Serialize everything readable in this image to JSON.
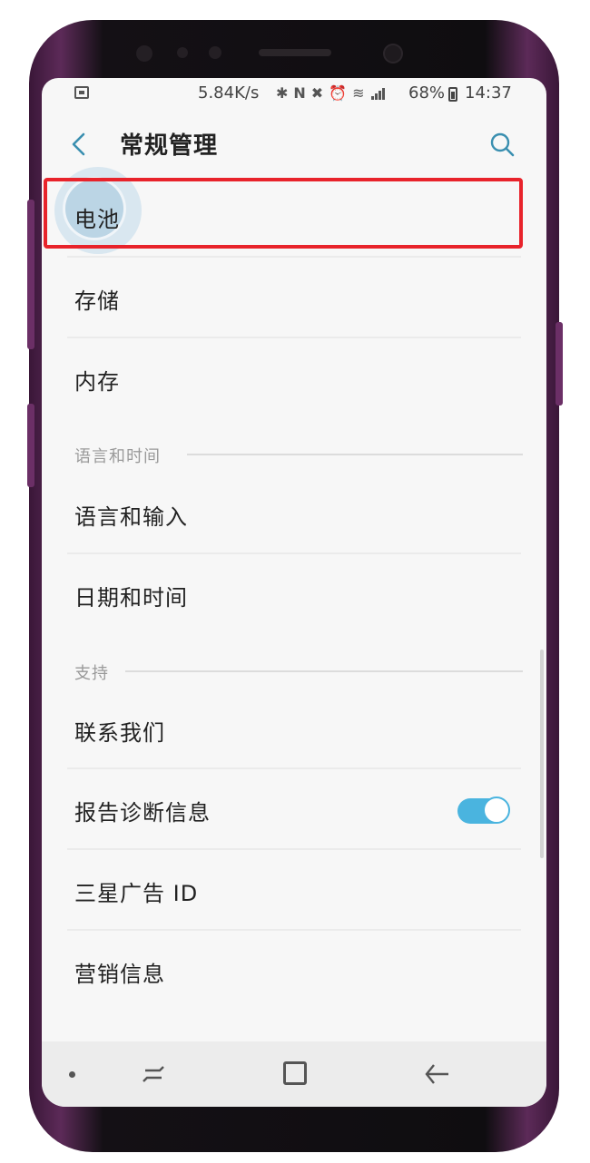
{
  "status_bar": {
    "net_speed": "5.84K/s",
    "icons": [
      "bluetooth-icon",
      "nfc-icon",
      "mute-icon",
      "alarm-icon",
      "wifi-icon",
      "signal-icon"
    ],
    "battery_percent": "68%",
    "time": "14:37"
  },
  "header": {
    "title": "常规管理",
    "back_icon": "chevron-left-icon",
    "search_icon": "search-icon"
  },
  "list": {
    "battery": "电池",
    "storage": "存储",
    "memory": "内存",
    "section_language_time": "语言和时间",
    "language_input": "语言和输入",
    "date_time": "日期和时间",
    "section_support": "支持",
    "contact_us": "联系我们",
    "report_diagnostics": "报告诊断信息",
    "report_diagnostics_enabled": true,
    "samsung_ad_id": "三星广告 ID",
    "marketing_info": "营销信息"
  },
  "colors": {
    "accent": "#4ab4df",
    "highlight_box": "#e8232b",
    "phone_frame": "#5c2a58"
  },
  "nav_bar": {
    "icons": [
      "dot-icon",
      "recent-apps-icon",
      "home-icon",
      "back-icon"
    ]
  }
}
